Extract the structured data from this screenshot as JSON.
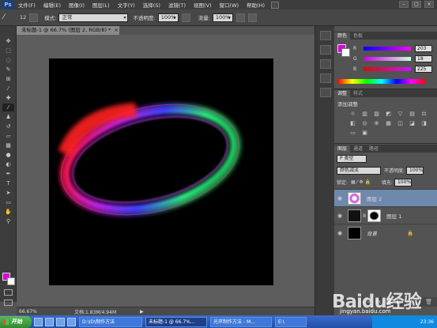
{
  "app": {
    "logo": "Ps"
  },
  "menu": [
    "文件(F)",
    "编辑(E)",
    "图像(I)",
    "图层(L)",
    "文字(Y)",
    "选择(S)",
    "滤镜(T)",
    "视图(V)",
    "窗口(W)",
    "帮助(H)"
  ],
  "window_controls": [
    "–",
    "□",
    "×"
  ],
  "options": {
    "brush_size": "12",
    "mode_label": "模式:",
    "mode_value": "正常",
    "opacity_label": "不透明度:",
    "opacity_value": "100%",
    "flow_label": "流量:",
    "flow_value": "100%"
  },
  "document": {
    "tab_title": "未标题-1 @ 66.7% (图层 2, RGB/8) *",
    "close": "×"
  },
  "status": {
    "zoom": "66.67%",
    "doc_size": "文档:1.83M/4.94M",
    "arrow": "▶"
  },
  "color_panel": {
    "tabs": [
      "颜色",
      "色板"
    ],
    "sliders": [
      {
        "label": "R",
        "value": "203",
        "gradient": "#0000ff,#ff00ff"
      },
      {
        "label": "G",
        "value": "18",
        "gradient": "#cc00e1,#ccffe1"
      },
      {
        "label": "B",
        "value": "225",
        "gradient": "#cb1200,#cb12ff"
      }
    ],
    "fg_color": "#d400d6",
    "bg_color": "#ffffff"
  },
  "adjustments": {
    "tabs": [
      "调整",
      "样式"
    ],
    "title": "添加调整"
  },
  "layers": {
    "tabs": [
      "图层",
      "通道",
      "路径"
    ],
    "filter_value": "P 类型",
    "blend_value": "颜色减淡",
    "opacity_label": "不透明度:",
    "opacity_value": "100%",
    "lock_label": "锁定:",
    "fill_label": "填充:",
    "fill_value": "100%",
    "items": [
      {
        "name": "图层 2"
      },
      {
        "name": "图层 1"
      },
      {
        "name": "背景"
      }
    ]
  },
  "taskbar": {
    "start": "开始",
    "tasks": [
      "D:\\ID\\制作方法",
      "未标题-1 @ 66.7%...",
      "光环制作方法 - M...",
      "E:\\"
    ],
    "clock": "23:36"
  },
  "watermark": {
    "brand": "Baidu经验",
    "url": "jingyan.baidu.com"
  }
}
